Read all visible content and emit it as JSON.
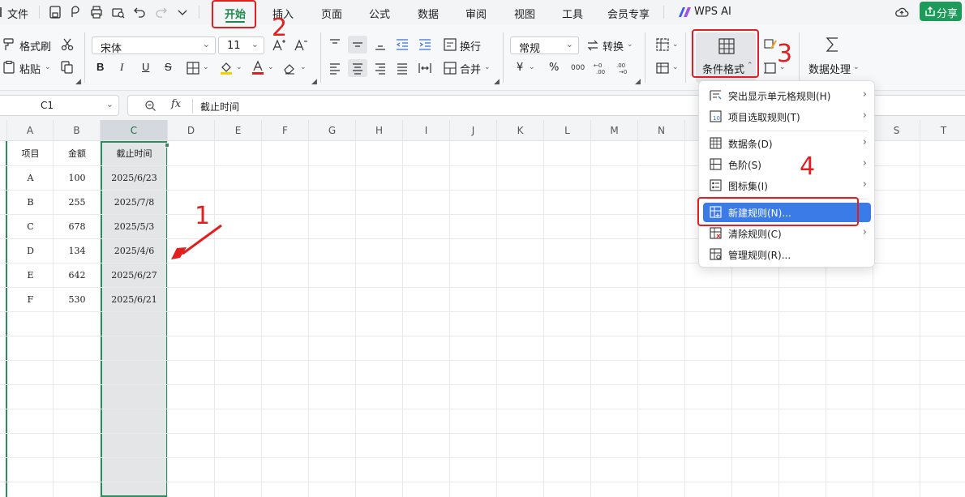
{
  "menubar": {
    "file_label": "文件",
    "tabs": [
      {
        "label": "开始",
        "active": true
      },
      {
        "label": "插入"
      },
      {
        "label": "页面"
      },
      {
        "label": "公式"
      },
      {
        "label": "数据"
      },
      {
        "label": "审阅"
      },
      {
        "label": "视图"
      },
      {
        "label": "工具"
      },
      {
        "label": "会员专享"
      },
      {
        "label": "WPS AI"
      }
    ],
    "share_label": "分享",
    "accent_color": "#1e8a4c"
  },
  "ribbon": {
    "format_painter": "格式刷",
    "paste": "粘贴",
    "font_name": "宋体",
    "font_size": "11",
    "bold": "B",
    "italic": "I",
    "underline": "U",
    "strike": "S",
    "wrap": "换行",
    "merge": "合并",
    "number_format": "常规",
    "convert": "转换",
    "conditional_format": "条件格式",
    "data_processing": "数据处理",
    "percent": "%",
    "yen": "¥"
  },
  "formula_bar": {
    "name_box": "C1",
    "fx": "fx",
    "content": "截止时间"
  },
  "sheet": {
    "columns": [
      "A",
      "B",
      "C",
      "D",
      "E",
      "F",
      "G",
      "H",
      "I",
      "J",
      "K",
      "L",
      "M",
      "N",
      "O",
      "P",
      "Q",
      "R",
      "S",
      "T"
    ],
    "selected_column": "C",
    "headers": [
      "项目",
      "金额",
      "截止时间"
    ],
    "rows": [
      [
        "A",
        "100",
        "2025/6/23"
      ],
      [
        "B",
        "255",
        "2025/7/8"
      ],
      [
        "C",
        "678",
        "2025/5/3"
      ],
      [
        "D",
        "134",
        "2025/4/6"
      ],
      [
        "E",
        "642",
        "2025/6/27"
      ],
      [
        "F",
        "530",
        "2025/6/21"
      ]
    ]
  },
  "conditional_menu": {
    "items": [
      {
        "label": "突出显示单元格规则(H)",
        "submenu": true
      },
      {
        "label": "项目选取规则(T)",
        "submenu": true
      },
      {
        "label": "数据条(D)",
        "submenu": true
      },
      {
        "label": "色阶(S)",
        "submenu": true
      },
      {
        "label": "图标集(I)",
        "submenu": true
      },
      {
        "label": "新建规则(N)...",
        "submenu": false,
        "highlighted": true
      },
      {
        "label": "清除规则(C)",
        "submenu": true
      },
      {
        "label": "管理规则(R)...",
        "submenu": false
      }
    ],
    "highlight_color": "#3b7be8"
  },
  "annotations": {
    "step1": "1",
    "step2": "2",
    "step3": "3",
    "step4": "4",
    "color": "#e02020"
  }
}
